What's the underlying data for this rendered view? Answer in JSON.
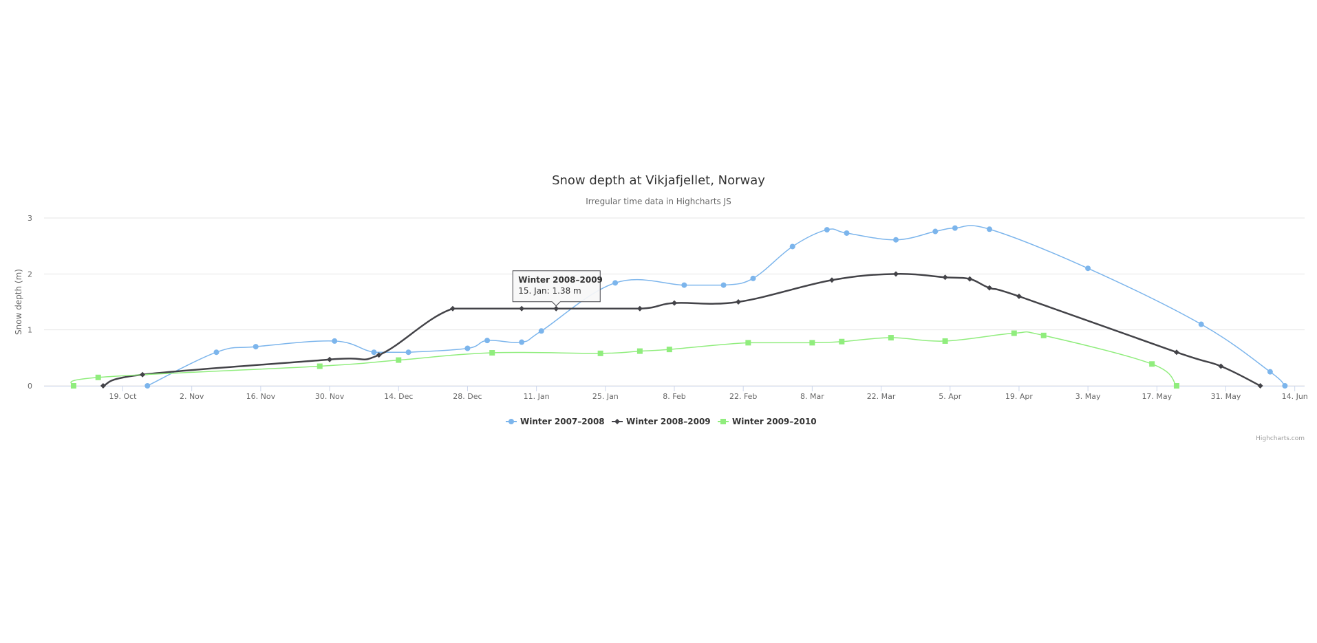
{
  "chart_data": {
    "type": "line",
    "title": "Snow depth at Vikjafjellet, Norway",
    "subtitle": "Irregular time data in Highcharts JS",
    "ylabel": "Snow depth (m)",
    "xlabel": "",
    "ylim": [
      0,
      3
    ],
    "y_ticks": [
      "0",
      "1",
      "2",
      "3"
    ],
    "xlim": [
      "1970-10-03",
      "1971-06-16"
    ],
    "x_ticks": [
      {
        "date": "1970-10-19",
        "label": "19. Oct"
      },
      {
        "date": "1970-11-02",
        "label": "2. Nov"
      },
      {
        "date": "1970-11-16",
        "label": "16. Nov"
      },
      {
        "date": "1970-11-30",
        "label": "30. Nov"
      },
      {
        "date": "1970-12-14",
        "label": "14. Dec"
      },
      {
        "date": "1970-12-28",
        "label": "28. Dec"
      },
      {
        "date": "1971-01-11",
        "label": "11. Jan"
      },
      {
        "date": "1971-01-25",
        "label": "25. Jan"
      },
      {
        "date": "1971-02-08",
        "label": "8. Feb"
      },
      {
        "date": "1971-02-22",
        "label": "22. Feb"
      },
      {
        "date": "1971-03-08",
        "label": "8. Mar"
      },
      {
        "date": "1971-03-22",
        "label": "22. Mar"
      },
      {
        "date": "1971-04-05",
        "label": "5. Apr"
      },
      {
        "date": "1971-04-19",
        "label": "19. Apr"
      },
      {
        "date": "1971-05-03",
        "label": "3. May"
      },
      {
        "date": "1971-05-17",
        "label": "17. May"
      },
      {
        "date": "1971-05-31",
        "label": "31. May"
      },
      {
        "date": "1971-06-14",
        "label": "14. Jun"
      }
    ],
    "grid": true,
    "legend_position": "bottom-center",
    "series": [
      {
        "name": "Winter 2007–2008",
        "color": "#7cb5ec",
        "marker": "circle",
        "line_width": 1.5,
        "points": [
          [
            "1970-10-24",
            0
          ],
          [
            "1970-11-07",
            0.6
          ],
          [
            "1970-11-15",
            0.7
          ],
          [
            "1970-12-01",
            0.8
          ],
          [
            "1970-12-09",
            0.6
          ],
          [
            "1970-12-16",
            0.6
          ],
          [
            "1970-12-28",
            0.67
          ],
          [
            "1971-01-01",
            0.81
          ],
          [
            "1971-01-08",
            0.78
          ],
          [
            "1971-01-12",
            0.98
          ],
          [
            "1971-01-27",
            1.84
          ],
          [
            "1971-02-10",
            1.8
          ],
          [
            "1971-02-18",
            1.8
          ],
          [
            "1971-02-24",
            1.92
          ],
          [
            "1971-03-04",
            2.49
          ],
          [
            "1971-03-11",
            2.79
          ],
          [
            "1971-03-15",
            2.73
          ],
          [
            "1971-03-25",
            2.61
          ],
          [
            "1971-04-02",
            2.76
          ],
          [
            "1971-04-06",
            2.82
          ],
          [
            "1971-04-13",
            2.8
          ],
          [
            "1971-05-03",
            2.1
          ],
          [
            "1971-05-26",
            1.1
          ],
          [
            "1971-06-09",
            0.25
          ],
          [
            "1971-06-12",
            0
          ]
        ]
      },
      {
        "name": "Winter 2008–2009",
        "color": "#434348",
        "marker": "diamond",
        "line_width": 2.5,
        "points": [
          [
            "1970-10-15",
            0
          ],
          [
            "1970-10-23",
            0.2
          ],
          [
            "1970-11-30",
            0.47
          ],
          [
            "1970-12-10",
            0.55
          ],
          [
            "1970-12-25",
            1.38
          ],
          [
            "1971-01-08",
            1.38
          ],
          [
            "1971-01-15",
            1.38
          ],
          [
            "1971-02-01",
            1.38
          ],
          [
            "1971-02-08",
            1.48
          ],
          [
            "1971-02-21",
            1.5
          ],
          [
            "1971-03-12",
            1.89
          ],
          [
            "1971-03-25",
            2.0
          ],
          [
            "1971-04-04",
            1.94
          ],
          [
            "1971-04-09",
            1.91
          ],
          [
            "1971-04-13",
            1.75
          ],
          [
            "1971-04-19",
            1.6
          ],
          [
            "1971-05-21",
            0.6
          ],
          [
            "1971-05-30",
            0.35
          ],
          [
            "1971-06-07",
            0
          ]
        ]
      },
      {
        "name": "Winter 2009–2010",
        "color": "#90ed7d",
        "marker": "square",
        "line_width": 1.5,
        "points": [
          [
            "1970-10-09",
            0
          ],
          [
            "1970-10-14",
            0.15
          ],
          [
            "1970-11-28",
            0.35
          ],
          [
            "1970-12-14",
            0.46
          ],
          [
            "1971-01-02",
            0.59
          ],
          [
            "1971-01-24",
            0.58
          ],
          [
            "1971-02-01",
            0.62
          ],
          [
            "1971-02-07",
            0.65
          ],
          [
            "1971-02-23",
            0.77
          ],
          [
            "1971-03-08",
            0.77
          ],
          [
            "1971-03-14",
            0.79
          ],
          [
            "1971-03-24",
            0.86
          ],
          [
            "1971-04-04",
            0.8
          ],
          [
            "1971-04-18",
            0.94
          ],
          [
            "1971-04-24",
            0.9
          ],
          [
            "1971-05-16",
            0.39
          ],
          [
            "1971-05-21",
            0
          ]
        ]
      }
    ],
    "tooltip": {
      "series_index": 1,
      "point_index": 6,
      "title": "Winter 2008–2009",
      "text": "15. Jan: 1.38 m"
    },
    "credits": "Highcharts.com"
  }
}
